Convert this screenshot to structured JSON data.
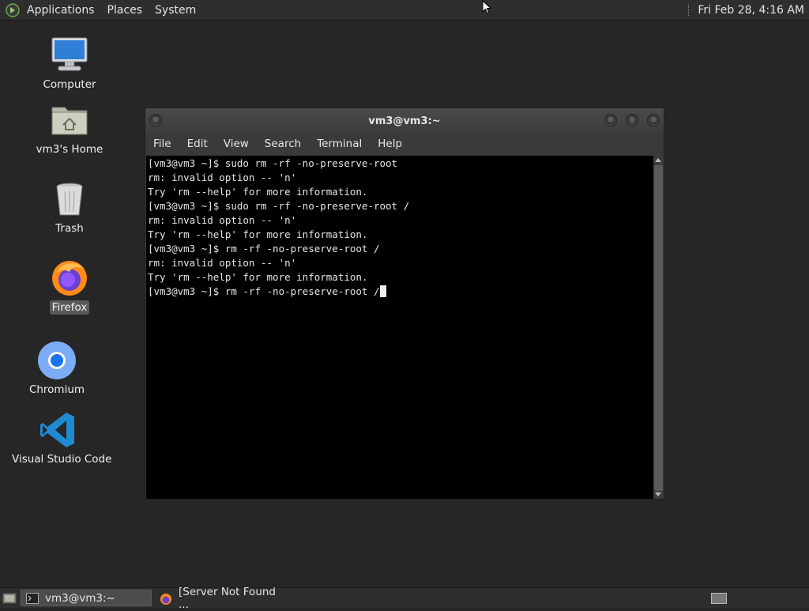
{
  "top_panel": {
    "menus": [
      "Applications",
      "Places",
      "System"
    ],
    "clock": "Fri Feb 28,  4:16 AM"
  },
  "desktop_icons": [
    {
      "label": "Computer",
      "icon": "computer-icon"
    },
    {
      "label": "vm3's Home",
      "icon": "home-folder-icon"
    },
    {
      "label": "Trash",
      "icon": "trash-icon"
    },
    {
      "label": "Firefox",
      "icon": "firefox-icon",
      "selected": true
    },
    {
      "label": "Chromium",
      "icon": "chromium-icon"
    },
    {
      "label": "Visual Studio Code",
      "icon": "vscode-icon"
    }
  ],
  "terminal": {
    "title": "vm3@vm3:~",
    "menus": [
      "File",
      "Edit",
      "View",
      "Search",
      "Terminal",
      "Help"
    ],
    "lines": [
      "[vm3@vm3 ~]$ sudo rm -rf -no-preserve-root",
      "rm: invalid option -- 'n'",
      "Try 'rm --help' for more information.",
      "[vm3@vm3 ~]$ sudo rm -rf -no-preserve-root /",
      "rm: invalid option -- 'n'",
      "Try 'rm --help' for more information.",
      "[vm3@vm3 ~]$ rm -rf -no-preserve-root /",
      "rm: invalid option -- 'n'",
      "Try 'rm --help' for more information."
    ],
    "current_input": "[vm3@vm3 ~]$ rm -rf -no-preserve-root /"
  },
  "taskbar": {
    "tasks": [
      {
        "label": "vm3@vm3:~",
        "icon": "terminal-icon",
        "active": true
      },
      {
        "label": "[Server Not Found ...",
        "icon": "firefox-icon",
        "active": false
      }
    ]
  },
  "colors": {
    "desktop_bg": "#262626",
    "panel_bg": "#2e2e2e",
    "terminal_bg": "#000000",
    "terminal_fg": "#e6e6e6"
  }
}
